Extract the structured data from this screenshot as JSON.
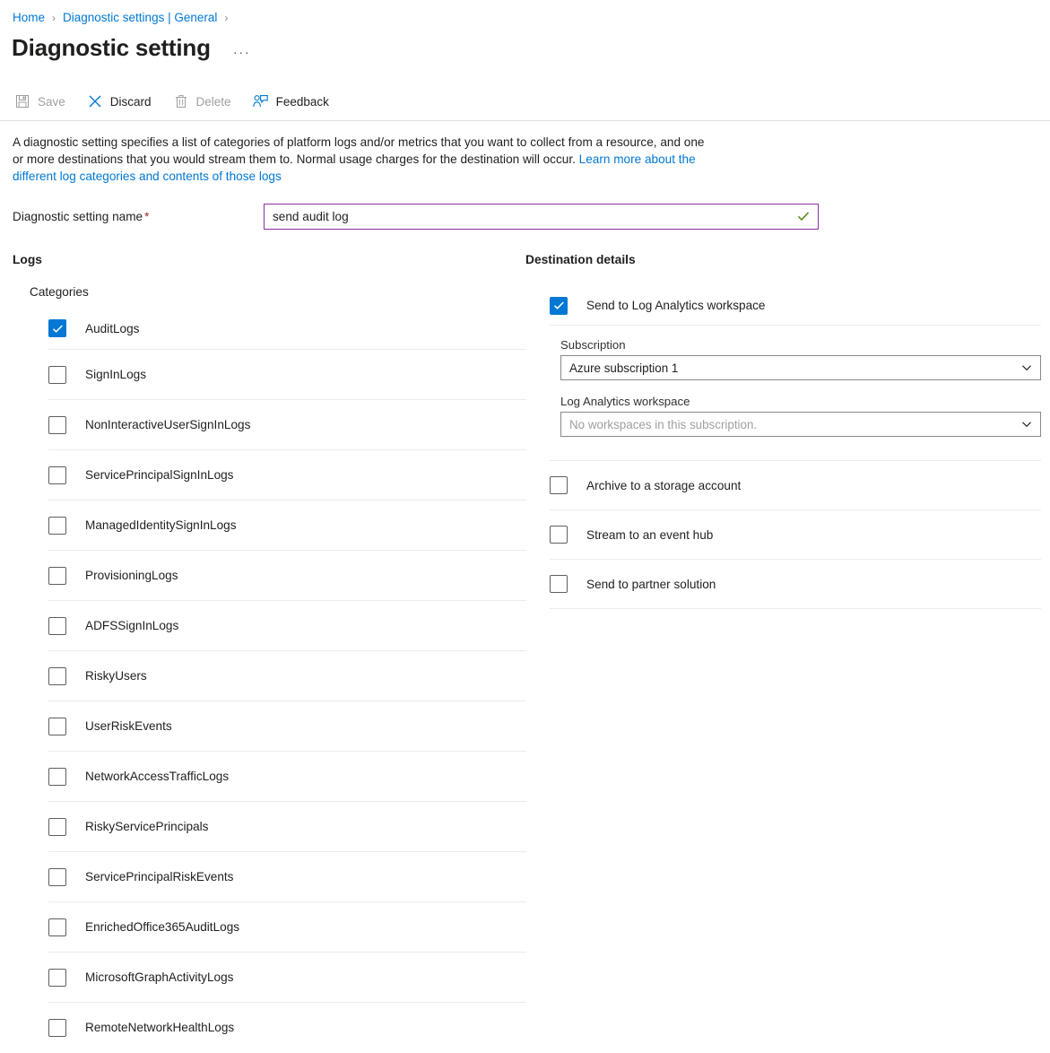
{
  "breadcrumb": {
    "items": [
      {
        "label": "Home",
        "icon": ""
      },
      {
        "label": "Diagnostic settings | General",
        "icon": ""
      }
    ],
    "separator": "›"
  },
  "header": {
    "title": "Diagnostic setting",
    "more_label": "···"
  },
  "toolbar": {
    "items": [
      {
        "label": "Save",
        "icon": "save-icon",
        "disabled": true
      },
      {
        "label": "Discard",
        "icon": "discard-icon",
        "disabled": false
      },
      {
        "label": "Delete",
        "icon": "delete-icon",
        "disabled": true
      },
      {
        "label": "Feedback",
        "icon": "feedback-icon",
        "disabled": false
      }
    ]
  },
  "description": {
    "text_part1": "A diagnostic setting specifies a list of categories of platform logs and/or metrics that you want to collect from a resource, and one or more destinations that you would stream them to. Normal usage charges for the destination will occur. ",
    "link_text": "Learn more about the different log categories and contents of those logs"
  },
  "name_field": {
    "label": "Diagnostic setting name",
    "required_marker": "*",
    "value": "send audit log",
    "placeholder": "",
    "border_color": "#8e2fa5",
    "valid_icon_color": "#498205"
  },
  "logs": {
    "section_title": "Logs",
    "subheading": "Categories",
    "categories": [
      {
        "label": "AuditLogs",
        "checked": true
      },
      {
        "label": "SignInLogs",
        "checked": false
      },
      {
        "label": "NonInteractiveUserSignInLogs",
        "checked": false
      },
      {
        "label": "ServicePrincipalSignInLogs",
        "checked": false
      },
      {
        "label": "ManagedIdentitySignInLogs",
        "checked": false
      },
      {
        "label": "ProvisioningLogs",
        "checked": false
      },
      {
        "label": "ADFSSignInLogs",
        "checked": false
      },
      {
        "label": "RiskyUsers",
        "checked": false
      },
      {
        "label": "UserRiskEvents",
        "checked": false
      },
      {
        "label": "NetworkAccessTrafficLogs",
        "checked": false
      },
      {
        "label": "RiskyServicePrincipals",
        "checked": false
      },
      {
        "label": "ServicePrincipalRiskEvents",
        "checked": false
      },
      {
        "label": "EnrichedOffice365AuditLogs",
        "checked": false
      },
      {
        "label": "MicrosoftGraphActivityLogs",
        "checked": false
      },
      {
        "label": "RemoteNetworkHealthLogs",
        "checked": false
      }
    ]
  },
  "destination": {
    "section_title": "Destination details",
    "log_analytics": {
      "label": "Send to Log Analytics workspace",
      "checked": true,
      "subscription_label": "Subscription",
      "subscription_value": "Azure subscription 1",
      "workspace_label": "Log Analytics workspace",
      "workspace_value": "No workspaces in this subscription.",
      "workspace_is_placeholder": true
    },
    "options": [
      {
        "label": "Archive to a storage account",
        "checked": false
      },
      {
        "label": "Stream to an event hub",
        "checked": false
      },
      {
        "label": "Send to partner solution",
        "checked": false
      }
    ]
  },
  "colors": {
    "accent": "#0078d4",
    "link": "#0078d4",
    "required": "#a4262c",
    "divider": "#edebe9",
    "text": "#201f1e",
    "disabled_text": "#a19f9d"
  }
}
